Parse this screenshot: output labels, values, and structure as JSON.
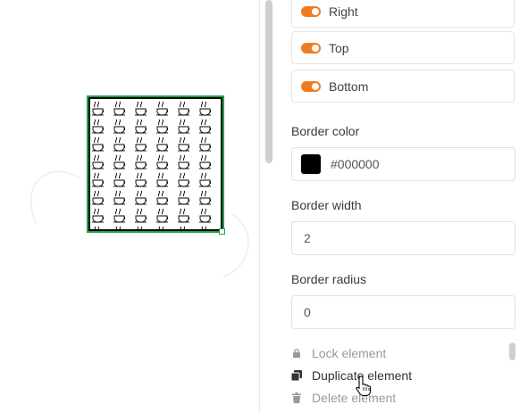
{
  "panel": {
    "toggles": [
      {
        "label": "Right",
        "on": true
      },
      {
        "label": "Top",
        "on": true
      },
      {
        "label": "Bottom",
        "on": true
      }
    ],
    "border_color": {
      "label": "Border color",
      "value": "#000000"
    },
    "border_width": {
      "label": "Border width",
      "value": "2"
    },
    "border_radius": {
      "label": "Border radius",
      "value": "0"
    },
    "actions": [
      {
        "label": "Lock element",
        "icon": "lock-icon",
        "enabled": false
      },
      {
        "label": "Duplicate element",
        "icon": "duplicate-icon",
        "enabled": true
      },
      {
        "label": "Delete element",
        "icon": "trash-icon",
        "enabled": false
      }
    ]
  },
  "colors": {
    "accent": "#f07b1f",
    "selection": "#1fa24a"
  }
}
